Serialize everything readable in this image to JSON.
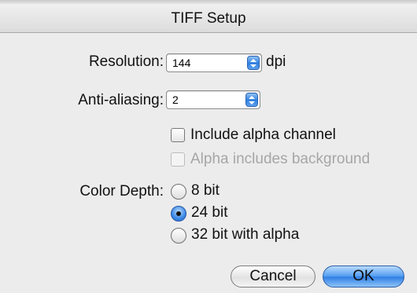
{
  "window": {
    "title": "TIFF Setup"
  },
  "resolution": {
    "label": "Resolution:",
    "value": "144",
    "unit": "dpi"
  },
  "antialiasing": {
    "label": "Anti-aliasing:",
    "value": "2"
  },
  "alpha": {
    "include_label": "Include alpha channel",
    "include_checked": false,
    "background_label": "Alpha includes background",
    "background_checked": false,
    "background_enabled": false
  },
  "color_depth": {
    "label": "Color Depth:",
    "options": [
      {
        "label": "8 bit",
        "selected": false
      },
      {
        "label": "24 bit",
        "selected": true
      },
      {
        "label": "32 bit with alpha",
        "selected": false
      }
    ]
  },
  "buttons": {
    "cancel": "Cancel",
    "ok": "OK"
  }
}
